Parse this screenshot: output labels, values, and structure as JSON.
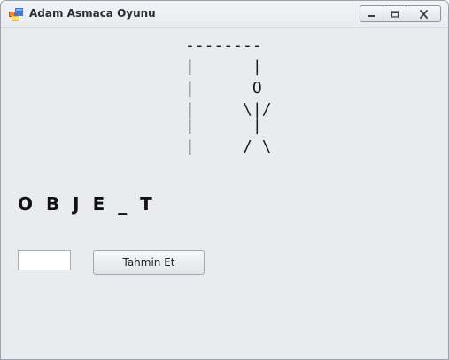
{
  "window": {
    "title": "Adam Asmaca Oyunu",
    "icon": "winforms-app-icon",
    "controls": {
      "minimize_icon": "minimize-icon",
      "maximize_icon": "maximize-icon",
      "close_icon": "close-icon"
    }
  },
  "gallows": {
    "lines": [
      "--------",
      "|      |",
      "|      O",
      "|     \\|/",
      "|      |",
      "|     / \\"
    ]
  },
  "game": {
    "word_display": "O B J E _ T"
  },
  "guess": {
    "input_value": "",
    "button_label": "Tahmin Et"
  },
  "colors": {
    "window_background": "#eaebef",
    "title_text": "#2b2d33",
    "word_text": "#111111"
  }
}
